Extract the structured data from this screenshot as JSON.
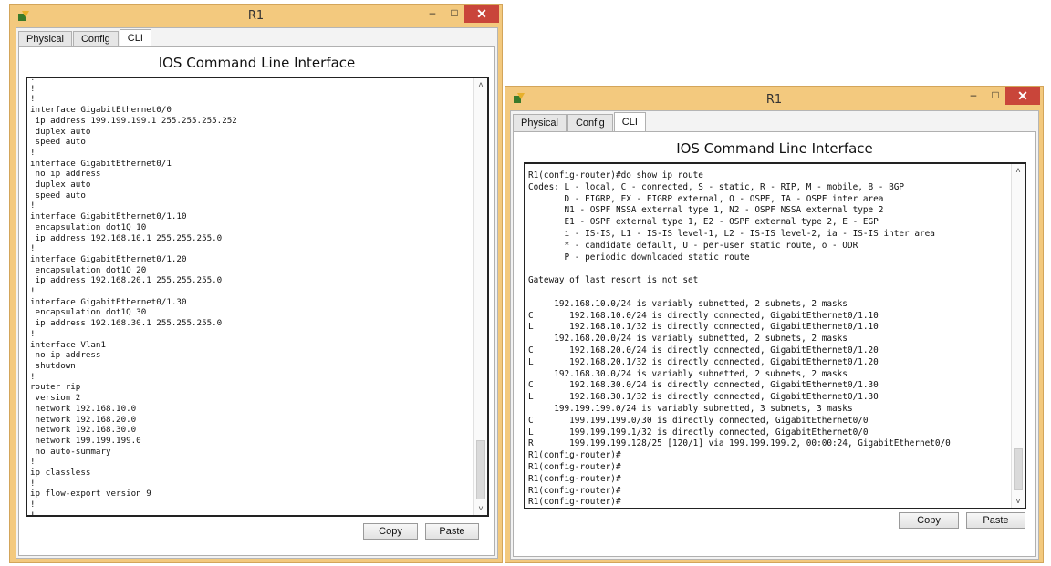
{
  "left_window": {
    "title": "R1",
    "controls": {
      "minimize": "–",
      "maximize": "□",
      "close": "✕"
    },
    "tabs": [
      {
        "label": "Physical",
        "active": false
      },
      {
        "label": "Config",
        "active": false
      },
      {
        "label": "CLI",
        "active": true
      }
    ],
    "heading": "IOS Command Line Interface",
    "terminal_lines": [
      "!",
      "!",
      "!",
      "interface GigabitEthernet0/0",
      " ip address 199.199.199.1 255.255.255.252",
      " duplex auto",
      " speed auto",
      "!",
      "interface GigabitEthernet0/1",
      " no ip address",
      " duplex auto",
      " speed auto",
      "!",
      "interface GigabitEthernet0/1.10",
      " encapsulation dot1Q 10",
      " ip address 192.168.10.1 255.255.255.0",
      "!",
      "interface GigabitEthernet0/1.20",
      " encapsulation dot1Q 20",
      " ip address 192.168.20.1 255.255.255.0",
      "!",
      "interface GigabitEthernet0/1.30",
      " encapsulation dot1Q 30",
      " ip address 192.168.30.1 255.255.255.0",
      "!",
      "interface Vlan1",
      " no ip address",
      " shutdown",
      "!",
      "router rip",
      " version 2",
      " network 192.168.10.0",
      " network 192.168.20.0",
      " network 192.168.30.0",
      " network 199.199.199.0",
      " no auto-summary",
      "!",
      "ip classless",
      "!",
      "ip flow-export version 9",
      "!",
      "!"
    ],
    "copy_label": "Copy",
    "paste_label": "Paste"
  },
  "right_window": {
    "title": "R1",
    "controls": {
      "minimize": "–",
      "maximize": "□",
      "close": "✕"
    },
    "tabs": [
      {
        "label": "Physical",
        "active": false
      },
      {
        "label": "Config",
        "active": false
      },
      {
        "label": "CLI",
        "active": true
      }
    ],
    "heading": "IOS Command Line Interface",
    "terminal_lines": [
      "R1(config-router)#do show ip route",
      "Codes: L - local, C - connected, S - static, R - RIP, M - mobile, B - BGP",
      "       D - EIGRP, EX - EIGRP external, O - OSPF, IA - OSPF inter area",
      "       N1 - OSPF NSSA external type 1, N2 - OSPF NSSA external type 2",
      "       E1 - OSPF external type 1, E2 - OSPF external type 2, E - EGP",
      "       i - IS-IS, L1 - IS-IS level-1, L2 - IS-IS level-2, ia - IS-IS inter area",
      "       * - candidate default, U - per-user static route, o - ODR",
      "       P - periodic downloaded static route",
      "",
      "Gateway of last resort is not set",
      "",
      "     192.168.10.0/24 is variably subnetted, 2 subnets, 2 masks",
      "C       192.168.10.0/24 is directly connected, GigabitEthernet0/1.10",
      "L       192.168.10.1/32 is directly connected, GigabitEthernet0/1.10",
      "     192.168.20.0/24 is variably subnetted, 2 subnets, 2 masks",
      "C       192.168.20.0/24 is directly connected, GigabitEthernet0/1.20",
      "L       192.168.20.1/32 is directly connected, GigabitEthernet0/1.20",
      "     192.168.30.0/24 is variably subnetted, 2 subnets, 2 masks",
      "C       192.168.30.0/24 is directly connected, GigabitEthernet0/1.30",
      "L       192.168.30.1/32 is directly connected, GigabitEthernet0/1.30",
      "     199.199.199.0/24 is variably subnetted, 3 subnets, 3 masks",
      "C       199.199.199.0/30 is directly connected, GigabitEthernet0/0",
      "L       199.199.199.1/32 is directly connected, GigabitEthernet0/0",
      "R       199.199.199.128/25 [120/1] via 199.199.199.2, 00:00:24, GigabitEthernet0/0",
      "R1(config-router)#",
      "R1(config-router)#",
      "R1(config-router)#",
      "R1(config-router)#",
      "R1(config-router)#"
    ],
    "copy_label": "Copy",
    "paste_label": "Paste"
  }
}
